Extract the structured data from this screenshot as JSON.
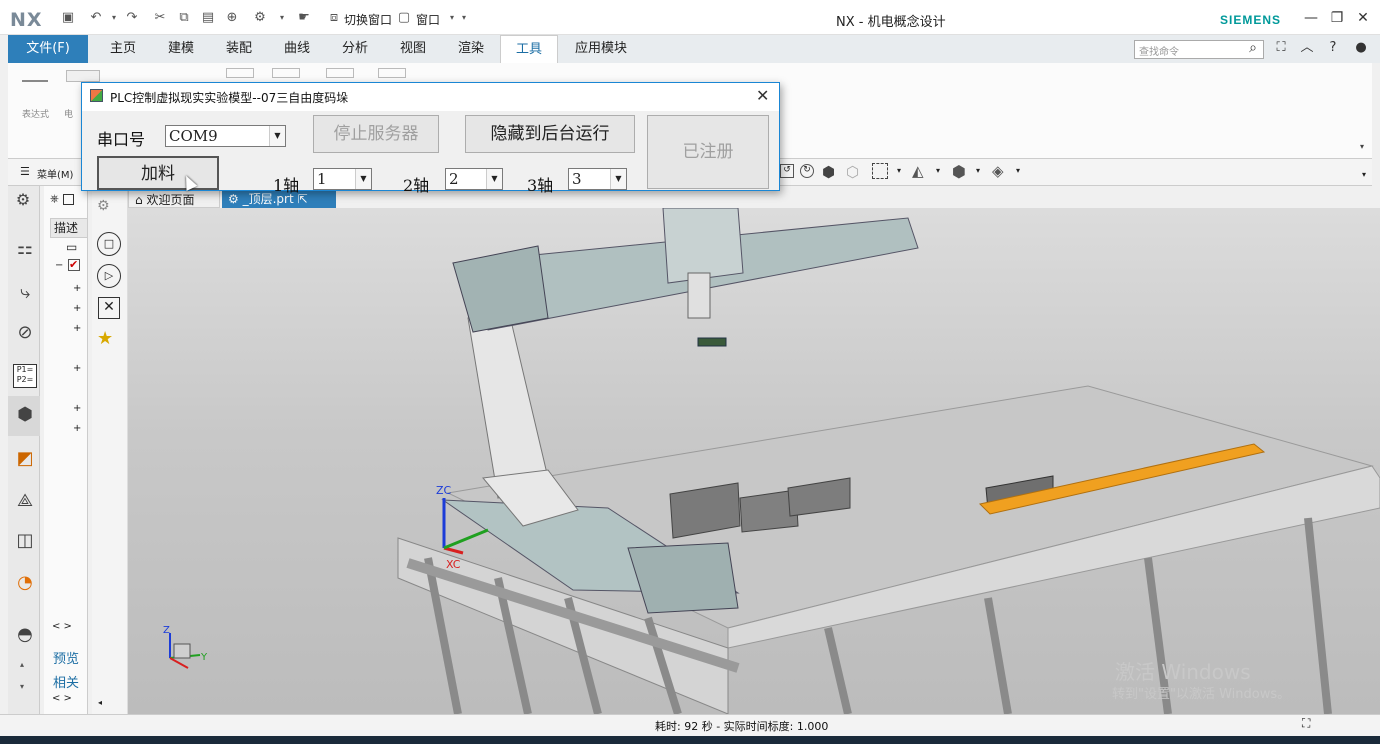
{
  "app": {
    "logo": "NX",
    "title": "NX - 机电概念设计",
    "brand": "SIEMENS"
  },
  "quick_access": {
    "switch_window": "切换窗口",
    "window": "窗口"
  },
  "ribbon_tabs": [
    {
      "label": "文件(F)"
    },
    {
      "label": "主页"
    },
    {
      "label": "建模"
    },
    {
      "label": "装配"
    },
    {
      "label": "曲线"
    },
    {
      "label": "分析"
    },
    {
      "label": "视图"
    },
    {
      "label": "渲染"
    },
    {
      "label": "工具",
      "active": true
    },
    {
      "label": "应用模块"
    }
  ],
  "search": {
    "placeholder": "查找命令"
  },
  "ribbon_body": {
    "expr_label": "表达式",
    "elec_label": "电"
  },
  "command_bar": {
    "menu_label": "菜单(M)"
  },
  "navigator": {
    "header": "描述",
    "preview_link": "预览",
    "related_link": "相关"
  },
  "file_tabs": [
    {
      "label": "欢迎页面"
    },
    {
      "label": "_顶层.prt"
    }
  ],
  "viewport": {
    "axis_zc": "ZC",
    "axis_xc": "XC",
    "triad_z": "Z",
    "triad_y": "Y"
  },
  "status": {
    "text": "耗时:  92 秒 - 实际时间标度:  1.000"
  },
  "watermark": {
    "line1": "激活 Windows",
    "line2": "转到\"设置\"以激活 Windows。"
  },
  "dialog": {
    "title": "PLC控制虚拟现实实验模型--07三自由度码垛",
    "serial_label": "串口号",
    "serial_value": "COM9",
    "stop_server": "停止服务器",
    "hide_background": "隐藏到后台运行",
    "registered": "已注册",
    "feed_button": "加料",
    "axis1_label": "1轴",
    "axis1_value": "1",
    "axis2_label": "2轴",
    "axis2_value": "2",
    "axis3_label": "3轴",
    "axis3_value": "3"
  },
  "colors": {
    "accent_blue": "#2e7fba",
    "siemens_teal": "#00999a",
    "rail_orange": "#f0a020"
  }
}
